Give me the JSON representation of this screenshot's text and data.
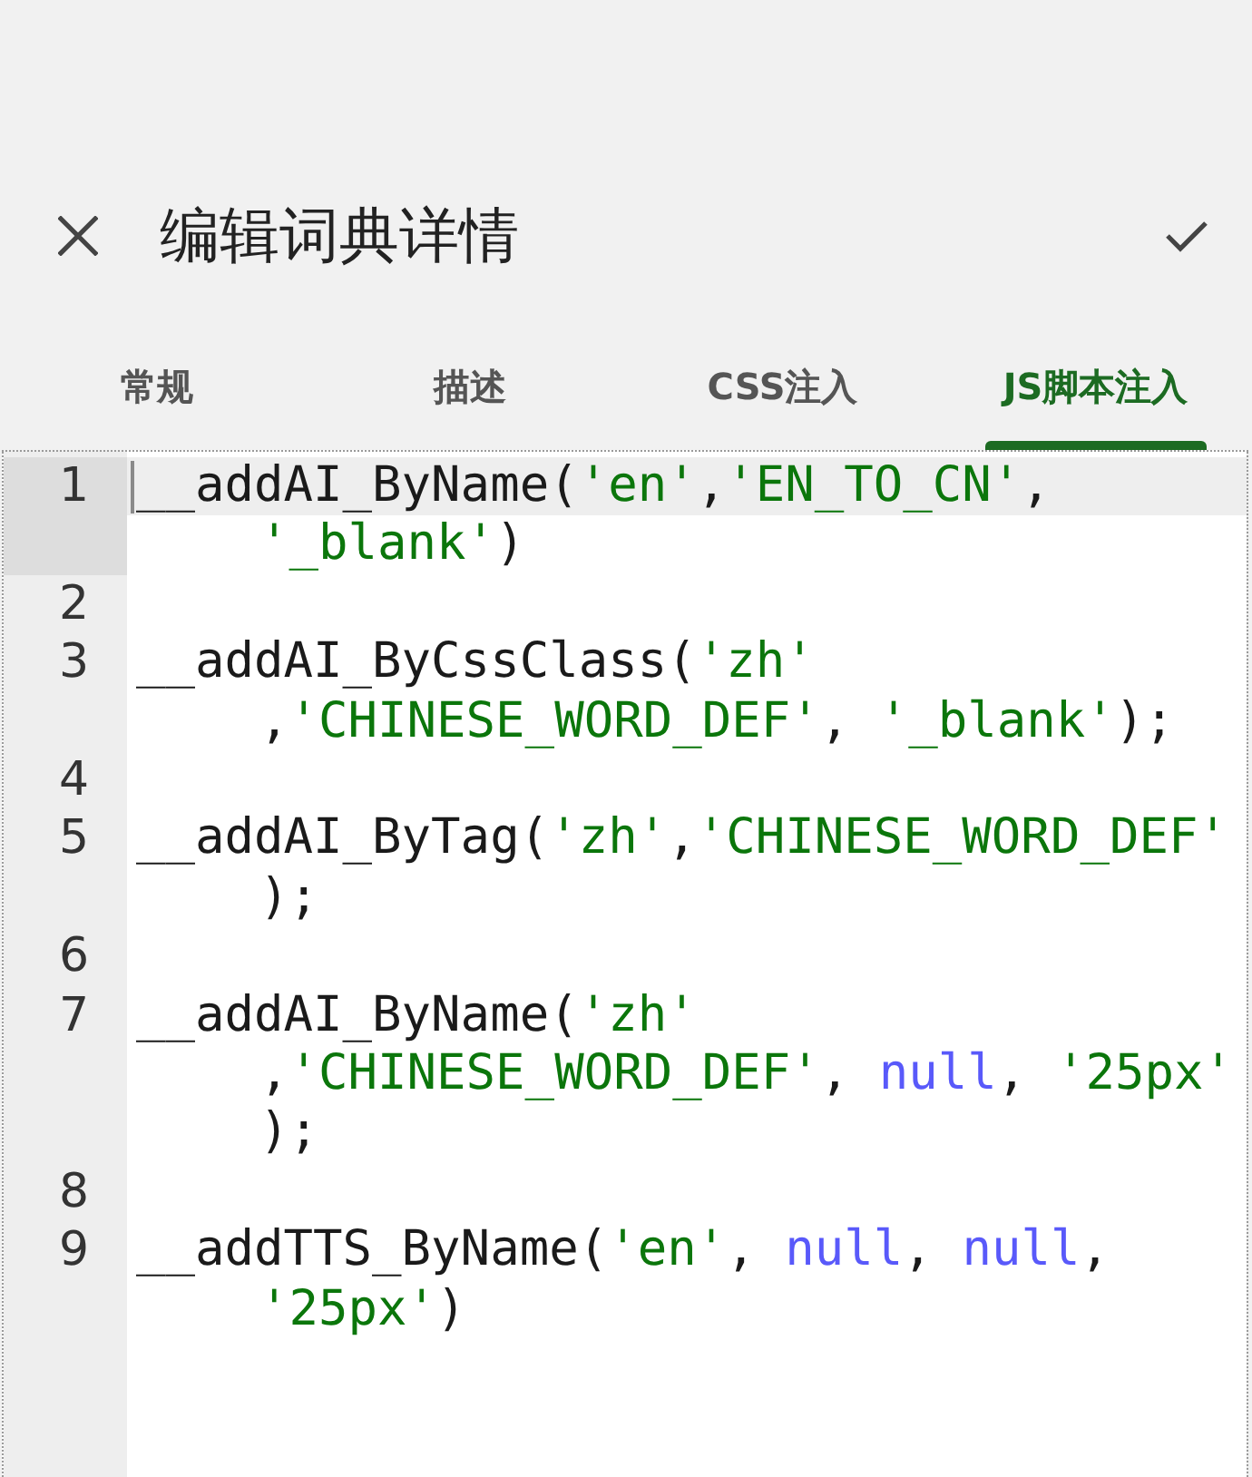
{
  "app_bar": {
    "title": "编辑词典详情"
  },
  "tabs": [
    {
      "label": "常规",
      "selected": false
    },
    {
      "label": "描述",
      "selected": false
    },
    {
      "label": "CSS注入",
      "selected": false
    },
    {
      "label": "JS脚本注入",
      "selected": true
    }
  ],
  "editor": {
    "lines": [
      {
        "number": "1",
        "current": true,
        "rows": [
          {
            "tokens": [
              {
                "kind": "plain",
                "text": "__addAI_ByName("
              },
              {
                "kind": "string",
                "text": "'en'"
              },
              {
                "kind": "plain",
                "text": ","
              },
              {
                "kind": "string",
                "text": "'EN_TO_CN'"
              },
              {
                "kind": "plain",
                "text": ","
              }
            ]
          },
          {
            "tokens": [
              {
                "kind": "string",
                "text": "'_blank'"
              },
              {
                "kind": "plain",
                "text": ")"
              }
            ]
          }
        ]
      },
      {
        "number": "2",
        "current": false
      },
      {
        "number": "3",
        "current": false,
        "rows": [
          {
            "tokens": [
              {
                "kind": "plain",
                "text": "__addAI_ByCssClass("
              },
              {
                "kind": "string",
                "text": "'zh'"
              }
            ]
          },
          {
            "tokens": [
              {
                "kind": "plain",
                "text": ","
              },
              {
                "kind": "string",
                "text": "'CHINESE_WORD_DEF'"
              },
              {
                "kind": "plain",
                "text": ", "
              },
              {
                "kind": "string",
                "text": "'_blank'"
              },
              {
                "kind": "plain",
                "text": ");"
              }
            ]
          }
        ]
      },
      {
        "number": "4",
        "current": false
      },
      {
        "number": "5",
        "current": false,
        "rows": [
          {
            "tokens": [
              {
                "kind": "plain",
                "text": "__addAI_ByTag("
              },
              {
                "kind": "string",
                "text": "'zh'"
              },
              {
                "kind": "plain",
                "text": ","
              },
              {
                "kind": "string",
                "text": "'CHINESE_WORD_DEF'"
              }
            ]
          },
          {
            "tokens": [
              {
                "kind": "plain",
                "text": ");"
              }
            ]
          }
        ]
      },
      {
        "number": "6",
        "current": false
      },
      {
        "number": "7",
        "current": false,
        "rows": [
          {
            "tokens": [
              {
                "kind": "plain",
                "text": "__addAI_ByName("
              },
              {
                "kind": "string",
                "text": "'zh'"
              }
            ]
          },
          {
            "tokens": [
              {
                "kind": "plain",
                "text": ","
              },
              {
                "kind": "string",
                "text": "'CHINESE_WORD_DEF'"
              },
              {
                "kind": "plain",
                "text": ", "
              },
              {
                "kind": "keyword",
                "text": "null"
              },
              {
                "kind": "plain",
                "text": ", "
              },
              {
                "kind": "string",
                "text": "'25px'"
              }
            ]
          },
          {
            "tokens": [
              {
                "kind": "plain",
                "text": ");"
              }
            ]
          }
        ]
      },
      {
        "number": "8",
        "current": false
      },
      {
        "number": "9",
        "current": false,
        "rows": [
          {
            "tokens": [
              {
                "kind": "plain",
                "text": "__addTTS_ByName("
              },
              {
                "kind": "string",
                "text": "'en'"
              },
              {
                "kind": "plain",
                "text": ", "
              },
              {
                "kind": "keyword",
                "text": "null"
              },
              {
                "kind": "plain",
                "text": ", "
              },
              {
                "kind": "keyword",
                "text": "null"
              },
              {
                "kind": "plain",
                "text": ","
              }
            ]
          },
          {
            "tokens": [
              {
                "kind": "string",
                "text": "'25px'"
              },
              {
                "kind": "plain",
                "text": ")"
              }
            ]
          }
        ]
      }
    ]
  }
}
